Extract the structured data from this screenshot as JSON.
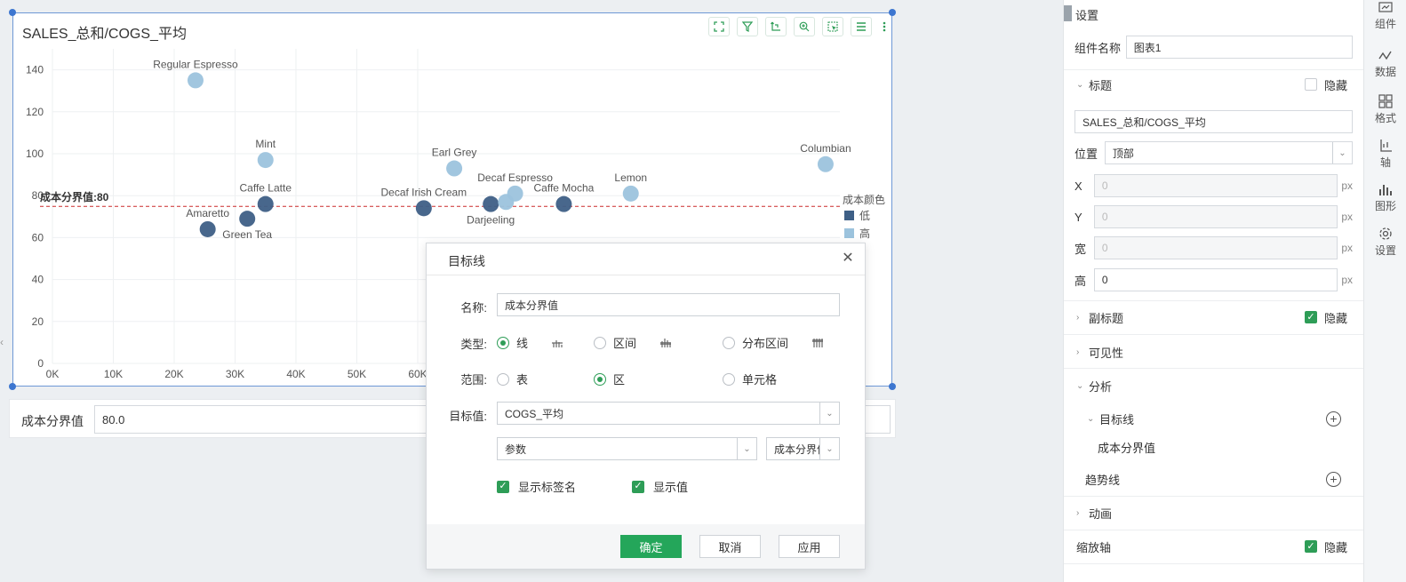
{
  "chart": {
    "title": "SALES_总和/COGS_平均",
    "toolbar_icons": [
      "fullscreen-icon",
      "filter-icon",
      "swap-axis-icon",
      "zoom-in-icon",
      "select-icon",
      "list-icon",
      "more-icon"
    ]
  },
  "chart_data": {
    "type": "scatter",
    "title": "SALES_总和/COGS_平均",
    "xlim": [
      0,
      130000
    ],
    "ylim": [
      0,
      150
    ],
    "x_ticks": [
      "0K",
      "10K",
      "20K",
      "30K",
      "40K",
      "50K",
      "60K"
    ],
    "y_ticks": [
      "0",
      "20",
      "40",
      "60",
      "80",
      "100",
      "120",
      "140"
    ],
    "grid": true,
    "legend": {
      "title": "成本颜色",
      "entries": [
        "低",
        "高"
      ],
      "position": "right"
    },
    "colors": {
      "低": "#3e5f86",
      "高": "#9cc3dd"
    },
    "target_line": {
      "label": "成本分界值:80",
      "value": 80,
      "color": "#cc2b2b"
    },
    "points": [
      {
        "label": "Regular Espresso",
        "x": 23500,
        "y": 135,
        "group": "高"
      },
      {
        "label": "Mint",
        "x": 35000,
        "y": 97,
        "group": "高"
      },
      {
        "label": "Caffe Latte",
        "x": 35000,
        "y": 76,
        "group": "低"
      },
      {
        "label": "Amaretto",
        "x": 25500,
        "y": 64,
        "group": "低"
      },
      {
        "label": "Green Tea",
        "x": 32000,
        "y": 69,
        "group": "低"
      },
      {
        "label": "Earl Grey",
        "x": 66000,
        "y": 93,
        "group": "高"
      },
      {
        "label": "Decaf Irish Cream",
        "x": 61000,
        "y": 74,
        "group": "低"
      },
      {
        "label": "Decaf Espresso",
        "x": 76000,
        "y": 81,
        "group": "高"
      },
      {
        "label": "Darjeeling",
        "x": 72000,
        "y": 76,
        "group": "低"
      },
      {
        "label": "",
        "x": 74500,
        "y": 77,
        "group": "高"
      },
      {
        "label": "Caffe Mocha",
        "x": 84000,
        "y": 76,
        "group": "低"
      },
      {
        "label": "Lemon",
        "x": 95000,
        "y": 81,
        "group": "高"
      },
      {
        "label": "Columbian",
        "x": 127000,
        "y": 95,
        "group": "高"
      }
    ]
  },
  "filter": {
    "label": "成本分界值",
    "value": "80.0"
  },
  "settings": {
    "header": "设置",
    "component_name_label": "组件名称",
    "component_name_value": "图表1",
    "title_section": "标题",
    "hide_label": "隐藏",
    "title_value": "SALES_总和/COGS_平均",
    "position_label": "位置",
    "position_value": "顶部",
    "x_label": "X",
    "x_value": "0",
    "y_label": "Y",
    "y_value": "0",
    "width_label": "宽",
    "width_value": "0",
    "height_label": "高",
    "height_value": "0",
    "unit": "px",
    "subtitle_section": "副标题",
    "visibility_section": "可见性",
    "analysis_section": "分析",
    "target_line_section": "目标线",
    "target_line_item": "成本分界值",
    "trend_line": "趋势线",
    "animation_section": "动画",
    "zoom_axis": "缩放轴"
  },
  "rail": [
    {
      "label": "组件",
      "icon": "component-icon"
    },
    {
      "label": "数据",
      "icon": "data-icon"
    },
    {
      "label": "格式",
      "icon": "format-icon"
    },
    {
      "label": "轴",
      "icon": "axis-icon"
    },
    {
      "label": "图形",
      "icon": "shape-icon"
    },
    {
      "label": "设置",
      "icon": "settings-gear-icon"
    }
  ],
  "dialog": {
    "title": "目标线",
    "name_label": "名称:",
    "name_value": "成本分界值",
    "type_label": "类型:",
    "type_options": [
      "线",
      "区间",
      "分布区间"
    ],
    "type_selected": "线",
    "range_label": "范围:",
    "range_options": [
      "表",
      "区",
      "单元格"
    ],
    "range_selected": "区",
    "target_label": "目标值:",
    "target_value": "COGS_平均",
    "param_value": "参数",
    "param_name": "成本分界值",
    "show_tag_label": "显示标签名",
    "show_value_label": "显示值",
    "ok": "确定",
    "cancel": "取消",
    "apply": "应用"
  }
}
